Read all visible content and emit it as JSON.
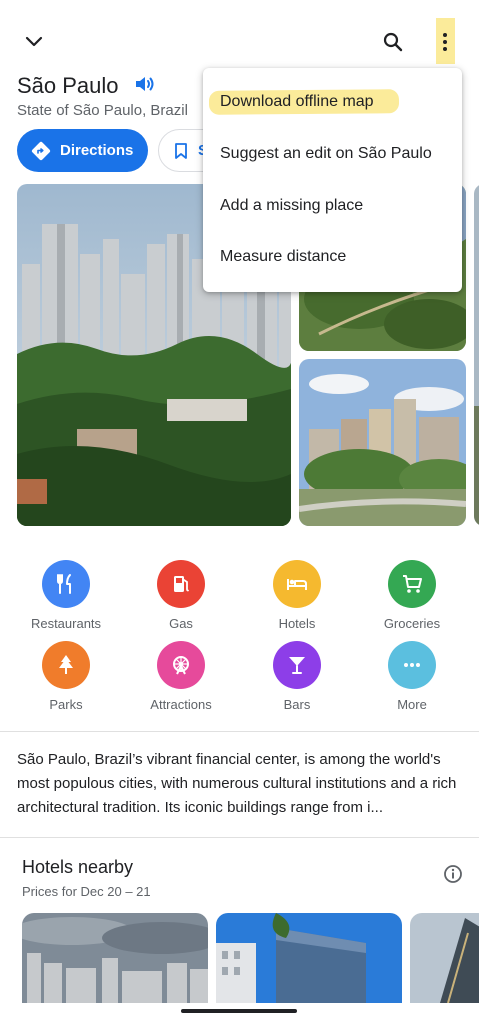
{
  "header": {
    "collapse_icon": "chevron-down-icon",
    "search_icon": "search-icon",
    "more_icon": "more-vert-icon"
  },
  "place": {
    "name": "São Paulo",
    "region": "State of São Paulo, Brazil",
    "speaker_icon": "volume-icon"
  },
  "actions": {
    "directions_label": "Directions",
    "save_label": "S"
  },
  "menu": {
    "items": [
      "Download offline map",
      "Suggest an edit on São Paulo",
      "Add a missing place",
      "Measure distance"
    ]
  },
  "categories": [
    {
      "label": "Restaurants",
      "icon": "restaurant-icon",
      "color": "#4285f4"
    },
    {
      "label": "Gas",
      "icon": "gas-station-icon",
      "color": "#ea4335"
    },
    {
      "label": "Hotels",
      "icon": "hotel-icon",
      "color": "#f5b92f"
    },
    {
      "label": "Groceries",
      "icon": "grocery-cart-icon",
      "color": "#34a853"
    },
    {
      "label": "Parks",
      "icon": "park-tree-icon",
      "color": "#f07c2b"
    },
    {
      "label": "Attractions",
      "icon": "ferris-wheel-icon",
      "color": "#e64a9b"
    },
    {
      "label": "Bars",
      "icon": "cocktail-icon",
      "color": "#8d3ee8"
    },
    {
      "label": "More",
      "icon": "more-horiz-icon",
      "color": "#5bbfdf"
    }
  ],
  "description": "São Paulo, Brazil’s vibrant financial center, is among the world's most populous cities, with numerous cultural institutions and a rich architectural tradition. Its iconic buildings range from i...",
  "hotels": {
    "title": "Hotels nearby",
    "subtitle": "Prices for Dec 20 – 21",
    "info_icon": "info-icon"
  },
  "colors": {
    "accent": "#1a73e8",
    "highlight": "#fbeb9a"
  }
}
